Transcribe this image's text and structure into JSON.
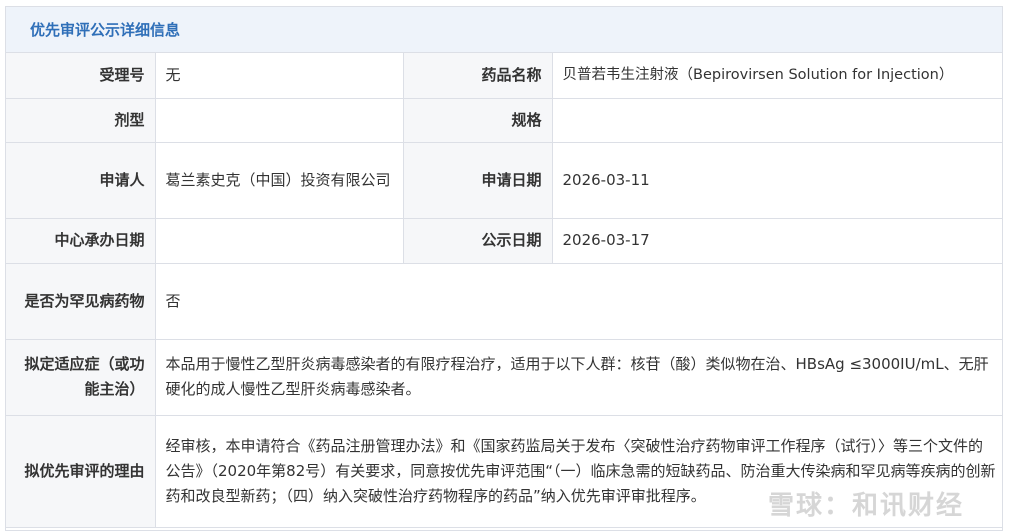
{
  "header": {
    "title": "优先审评公示详细信息"
  },
  "fields": {
    "acceptance_no": {
      "label": "受理号",
      "value": "无"
    },
    "drug_name": {
      "label": "药品名称",
      "value": "贝普若韦生注射液（Bepirovirsen Solution for Injection）"
    },
    "dosage_form": {
      "label": "剂型",
      "value": ""
    },
    "specification": {
      "label": "规格",
      "value": ""
    },
    "applicant": {
      "label": "申请人",
      "value": "葛兰素史克（中国）投资有限公司"
    },
    "application_date": {
      "label": "申请日期",
      "value": "2026-03-11"
    },
    "center_date": {
      "label": "中心承办日期",
      "value": ""
    },
    "publicity_date": {
      "label": "公示日期",
      "value": "2026-03-17"
    },
    "rare_disease": {
      "label": "是否为罕见病药物",
      "value": "否"
    },
    "indication": {
      "label": "拟定适应症（或功能主治）",
      "value": "本品用于慢性乙型肝炎病毒感染者的有限疗程治疗，适用于以下人群：核苷（酸）类似物在治、HBsAg ≤3000IU/mL、无肝硬化的成人慢性乙型肝炎病毒感染者。"
    },
    "priority_reason": {
      "label": "拟优先审评的理由",
      "value": "经审核，本申请符合《药品注册管理办法》和《国家药监局关于发布〈突破性治疗药物审评工作程序（试行）〉等三个文件的公告》（2020年第82号）有关要求，同意按优先审评范围“（一）临床急需的短缺药品、防治重大传染病和罕见病等疾病的创新药和改良型新药；（四）纳入突破性治疗药物程序的药品”纳入优先审评审批程序。"
    }
  },
  "watermark": {
    "text": "雪球：和讯财经"
  },
  "colors": {
    "header_bg": "#eef3fa",
    "header_text": "#2f6fb8",
    "label_bg": "#f6f7f9",
    "border": "#dcdfe6"
  }
}
